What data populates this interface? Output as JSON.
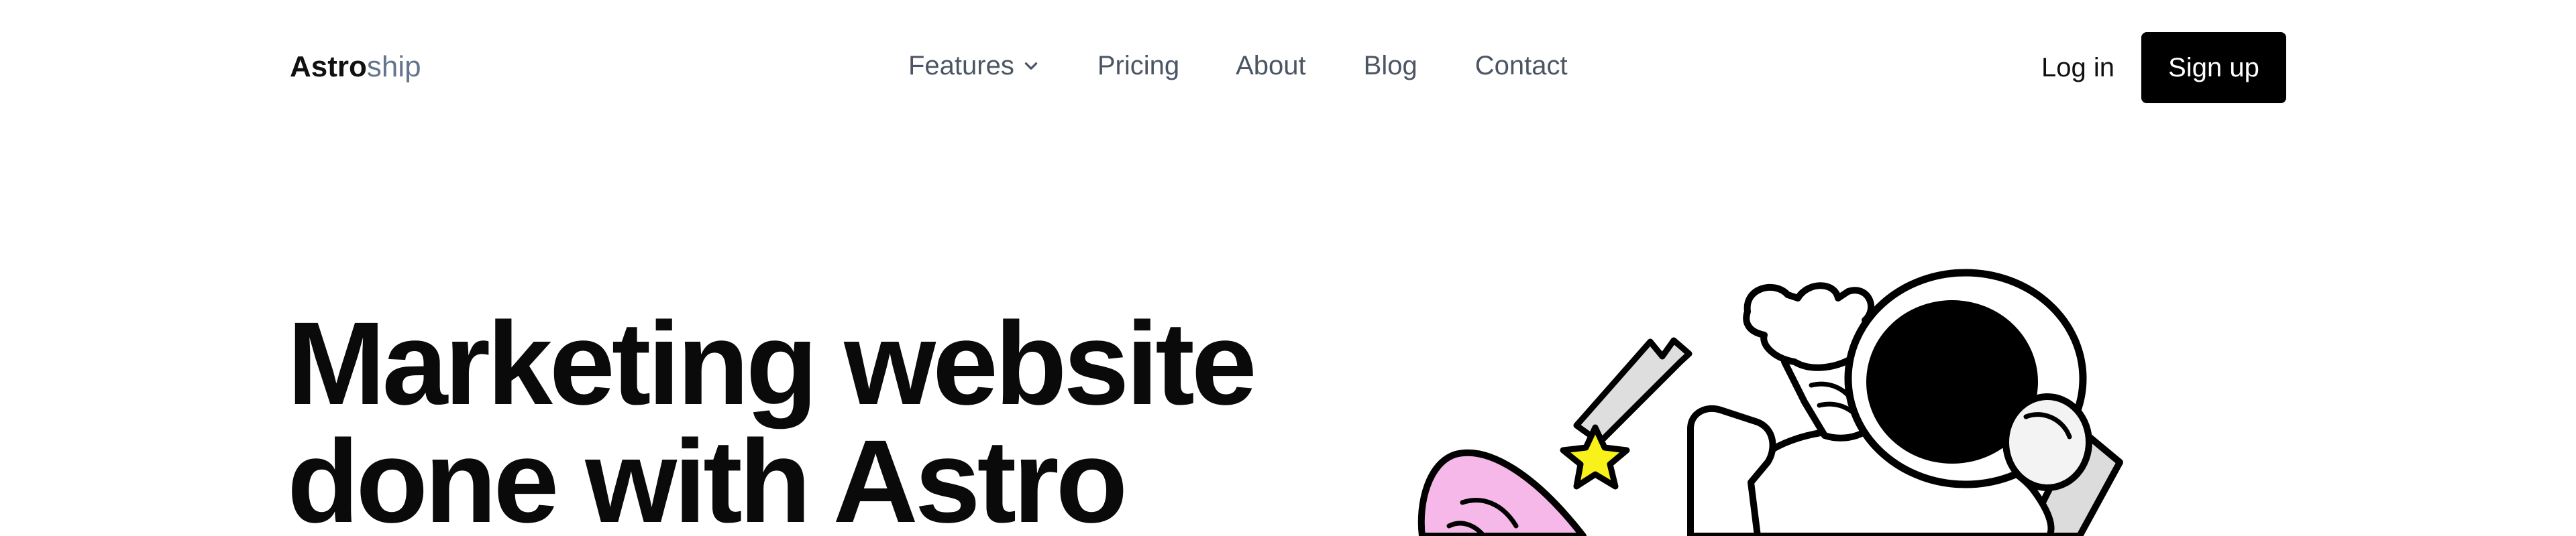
{
  "header": {
    "logo": {
      "bold": "Astro",
      "light": "ship"
    },
    "nav": [
      {
        "label": "Features",
        "has_dropdown": true,
        "icon": "chevron-down-icon"
      },
      {
        "label": "Pricing"
      },
      {
        "label": "About"
      },
      {
        "label": "Blog"
      },
      {
        "label": "Contact"
      }
    ],
    "login_label": "Log in",
    "signup_label": "Sign up"
  },
  "hero": {
    "title_line1": "Marketing website",
    "title_line2": "done with Astro",
    "illustration": "astronaut-rocket-illustration"
  },
  "colors": {
    "text": "#111111",
    "logo_light": "#64748b",
    "nav_text": "#4b5563",
    "button_bg": "#000000",
    "button_text": "#ffffff",
    "rocket_pink": "#f5b8e8",
    "star_yellow": "#f8f21a"
  }
}
